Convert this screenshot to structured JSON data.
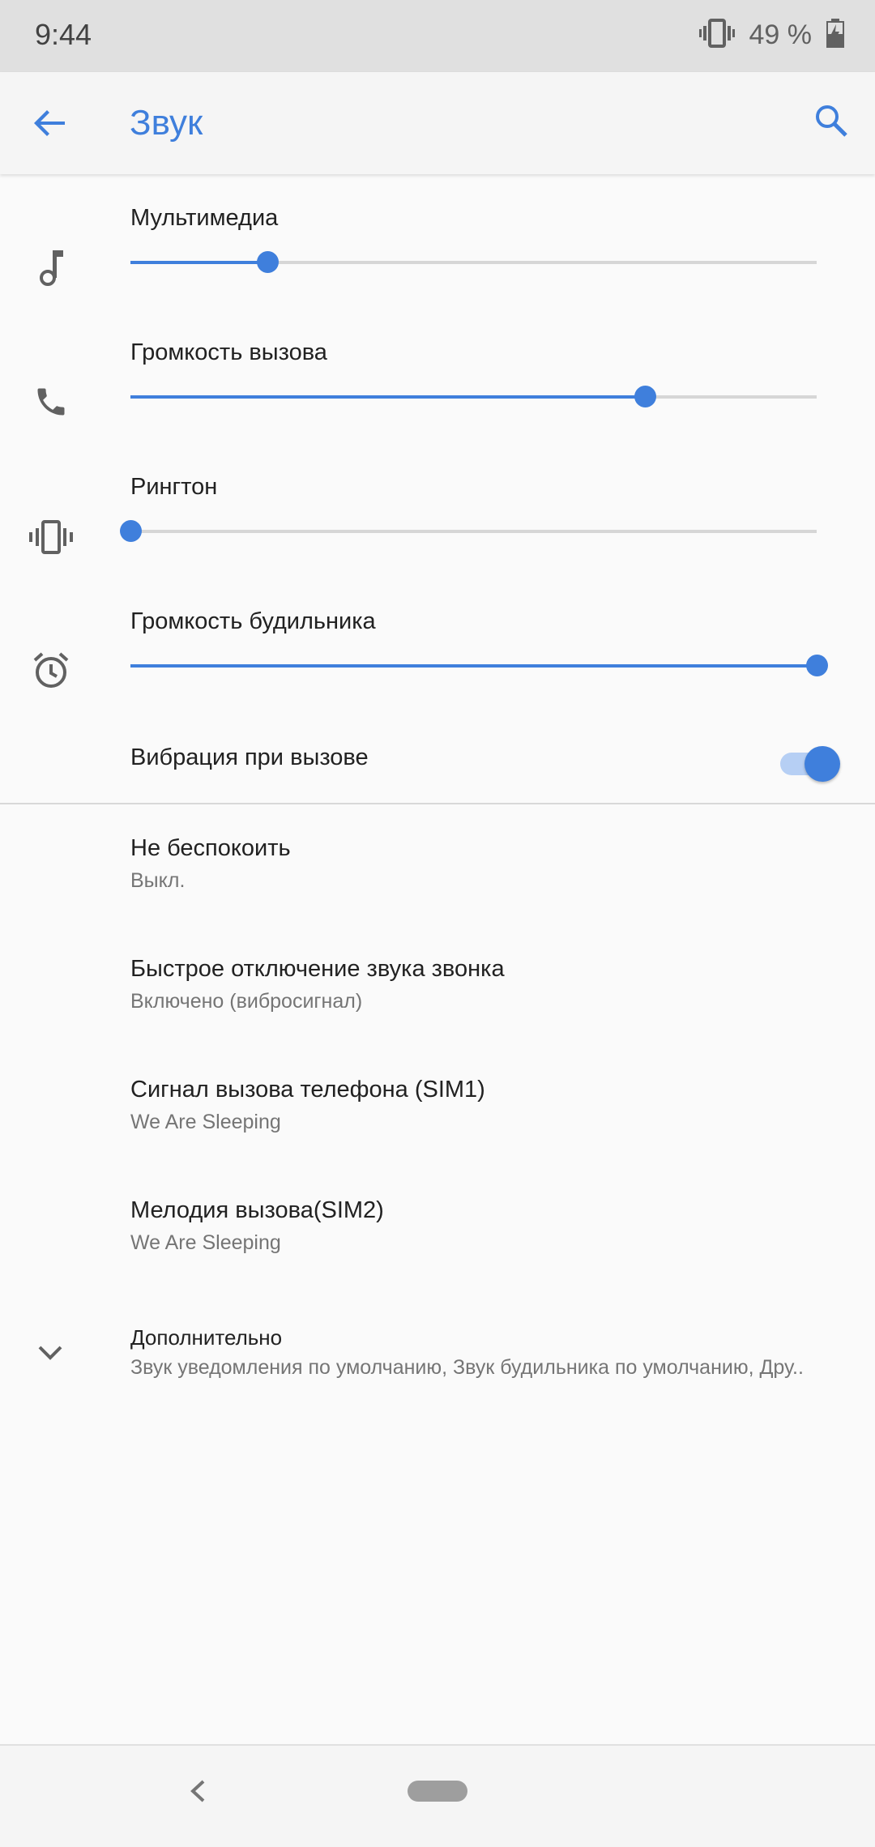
{
  "status_bar": {
    "time": "9:44",
    "battery_text": "49 %",
    "icons": [
      "vibrate-icon",
      "battery-icon"
    ]
  },
  "app_bar": {
    "title": "Звук",
    "back_icon": "arrow-back-icon",
    "search_icon": "search-icon"
  },
  "colors": {
    "accent": "#3f7fdc",
    "track": "#d6d6d6",
    "status_bar": "#e0e0e0",
    "background": "#fafafa"
  },
  "volumes": [
    {
      "label": "Мультимедиа",
      "icon": "music-note-icon",
      "level": 0.2
    },
    {
      "label": "Громкость вызова",
      "icon": "phone-icon",
      "level": 0.75
    },
    {
      "label": "Рингтон",
      "icon": "vibrate-icon",
      "level": 0.0
    },
    {
      "label": "Громкость будильника",
      "icon": "alarm-icon",
      "level": 1.0
    }
  ],
  "vibration": {
    "label": "Вибрация при вызове",
    "on": true
  },
  "prefs": [
    {
      "title": "Не беспокоить",
      "summary": "Выкл."
    },
    {
      "title": "Быстрое отключение звука звонка",
      "summary": "Включено (вибросигнал)"
    },
    {
      "title": "Сигнал вызова телефона (SIM1)",
      "summary": "We Are Sleeping"
    },
    {
      "title": "Мелодия вызова(SIM2)",
      "summary": "We Are Sleeping"
    }
  ],
  "advanced": {
    "title": "Дополнительно",
    "summary": "Звук уведомления по умолчанию, Звук будильника по умолчанию, Дру..",
    "icon": "chevron-down-icon"
  },
  "nav": {
    "back_icon": "nav-back-icon",
    "home_icon": "home-pill-icon"
  }
}
